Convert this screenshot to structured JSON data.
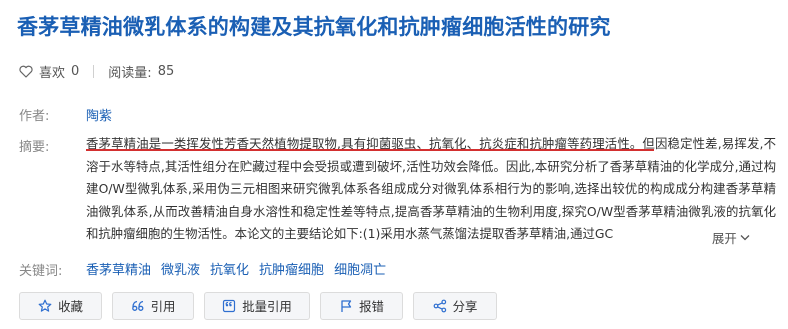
{
  "title": "香茅草精油微乳体系的构建及其抗氧化和抗肿瘤细胞活性的研究",
  "stats": {
    "like_label": "喜欢",
    "like_count": "0",
    "read_label": "阅读量:",
    "read_count": "85"
  },
  "author": {
    "label": "作者:",
    "name": "陶紫"
  },
  "abstract": {
    "label": "摘要:",
    "text": "香茅草精油是一类挥发性芳香天然植物提取物,具有抑菌驱虫、抗氧化、抗炎症和抗肿瘤等药理活性。但因稳定性差,易挥发,不溶于水等特点,其活性组分在贮藏过程中会受损或遭到破坏,活性功效会降低。因此,本研究分析了香茅草精油的化学成分,通过构建O/W型微乳体系,采用伪三元相图来研究微乳体系各组成成分对微乳体系相行为的影响,选择出较优的构成成分构建香茅草精油微乳体系,从而改善精油自身水溶性和稳定性差等特点,提高香茅草精油的生物利用度,探究O/W型香茅草精油微乳液的抗氧化和抗肿瘤细胞的生物活性。本论文的主要结论如下:(1)采用水蒸气蒸馏法提取香茅草精油,通过GC",
    "expand_label": "展开",
    "underline_color": "#d32f2f"
  },
  "keywords": {
    "label": "关键词:",
    "items": [
      "香茅草精油",
      "微乳液",
      "抗氧化",
      "抗肿瘤细胞",
      "细胞凋亡"
    ]
  },
  "actions": {
    "favorite": "收藏",
    "cite": "引用",
    "batch_cite": "批量引用",
    "report": "报错",
    "share": "分享"
  },
  "colors": {
    "link": "#1a5fb4",
    "label": "#888888",
    "button_bg": "#f5f6f8"
  },
  "icons": [
    "heart-outline-icon",
    "eye-icon",
    "star-icon",
    "quote-icon",
    "batch-cite-icon",
    "flag-icon",
    "share-icon"
  ]
}
